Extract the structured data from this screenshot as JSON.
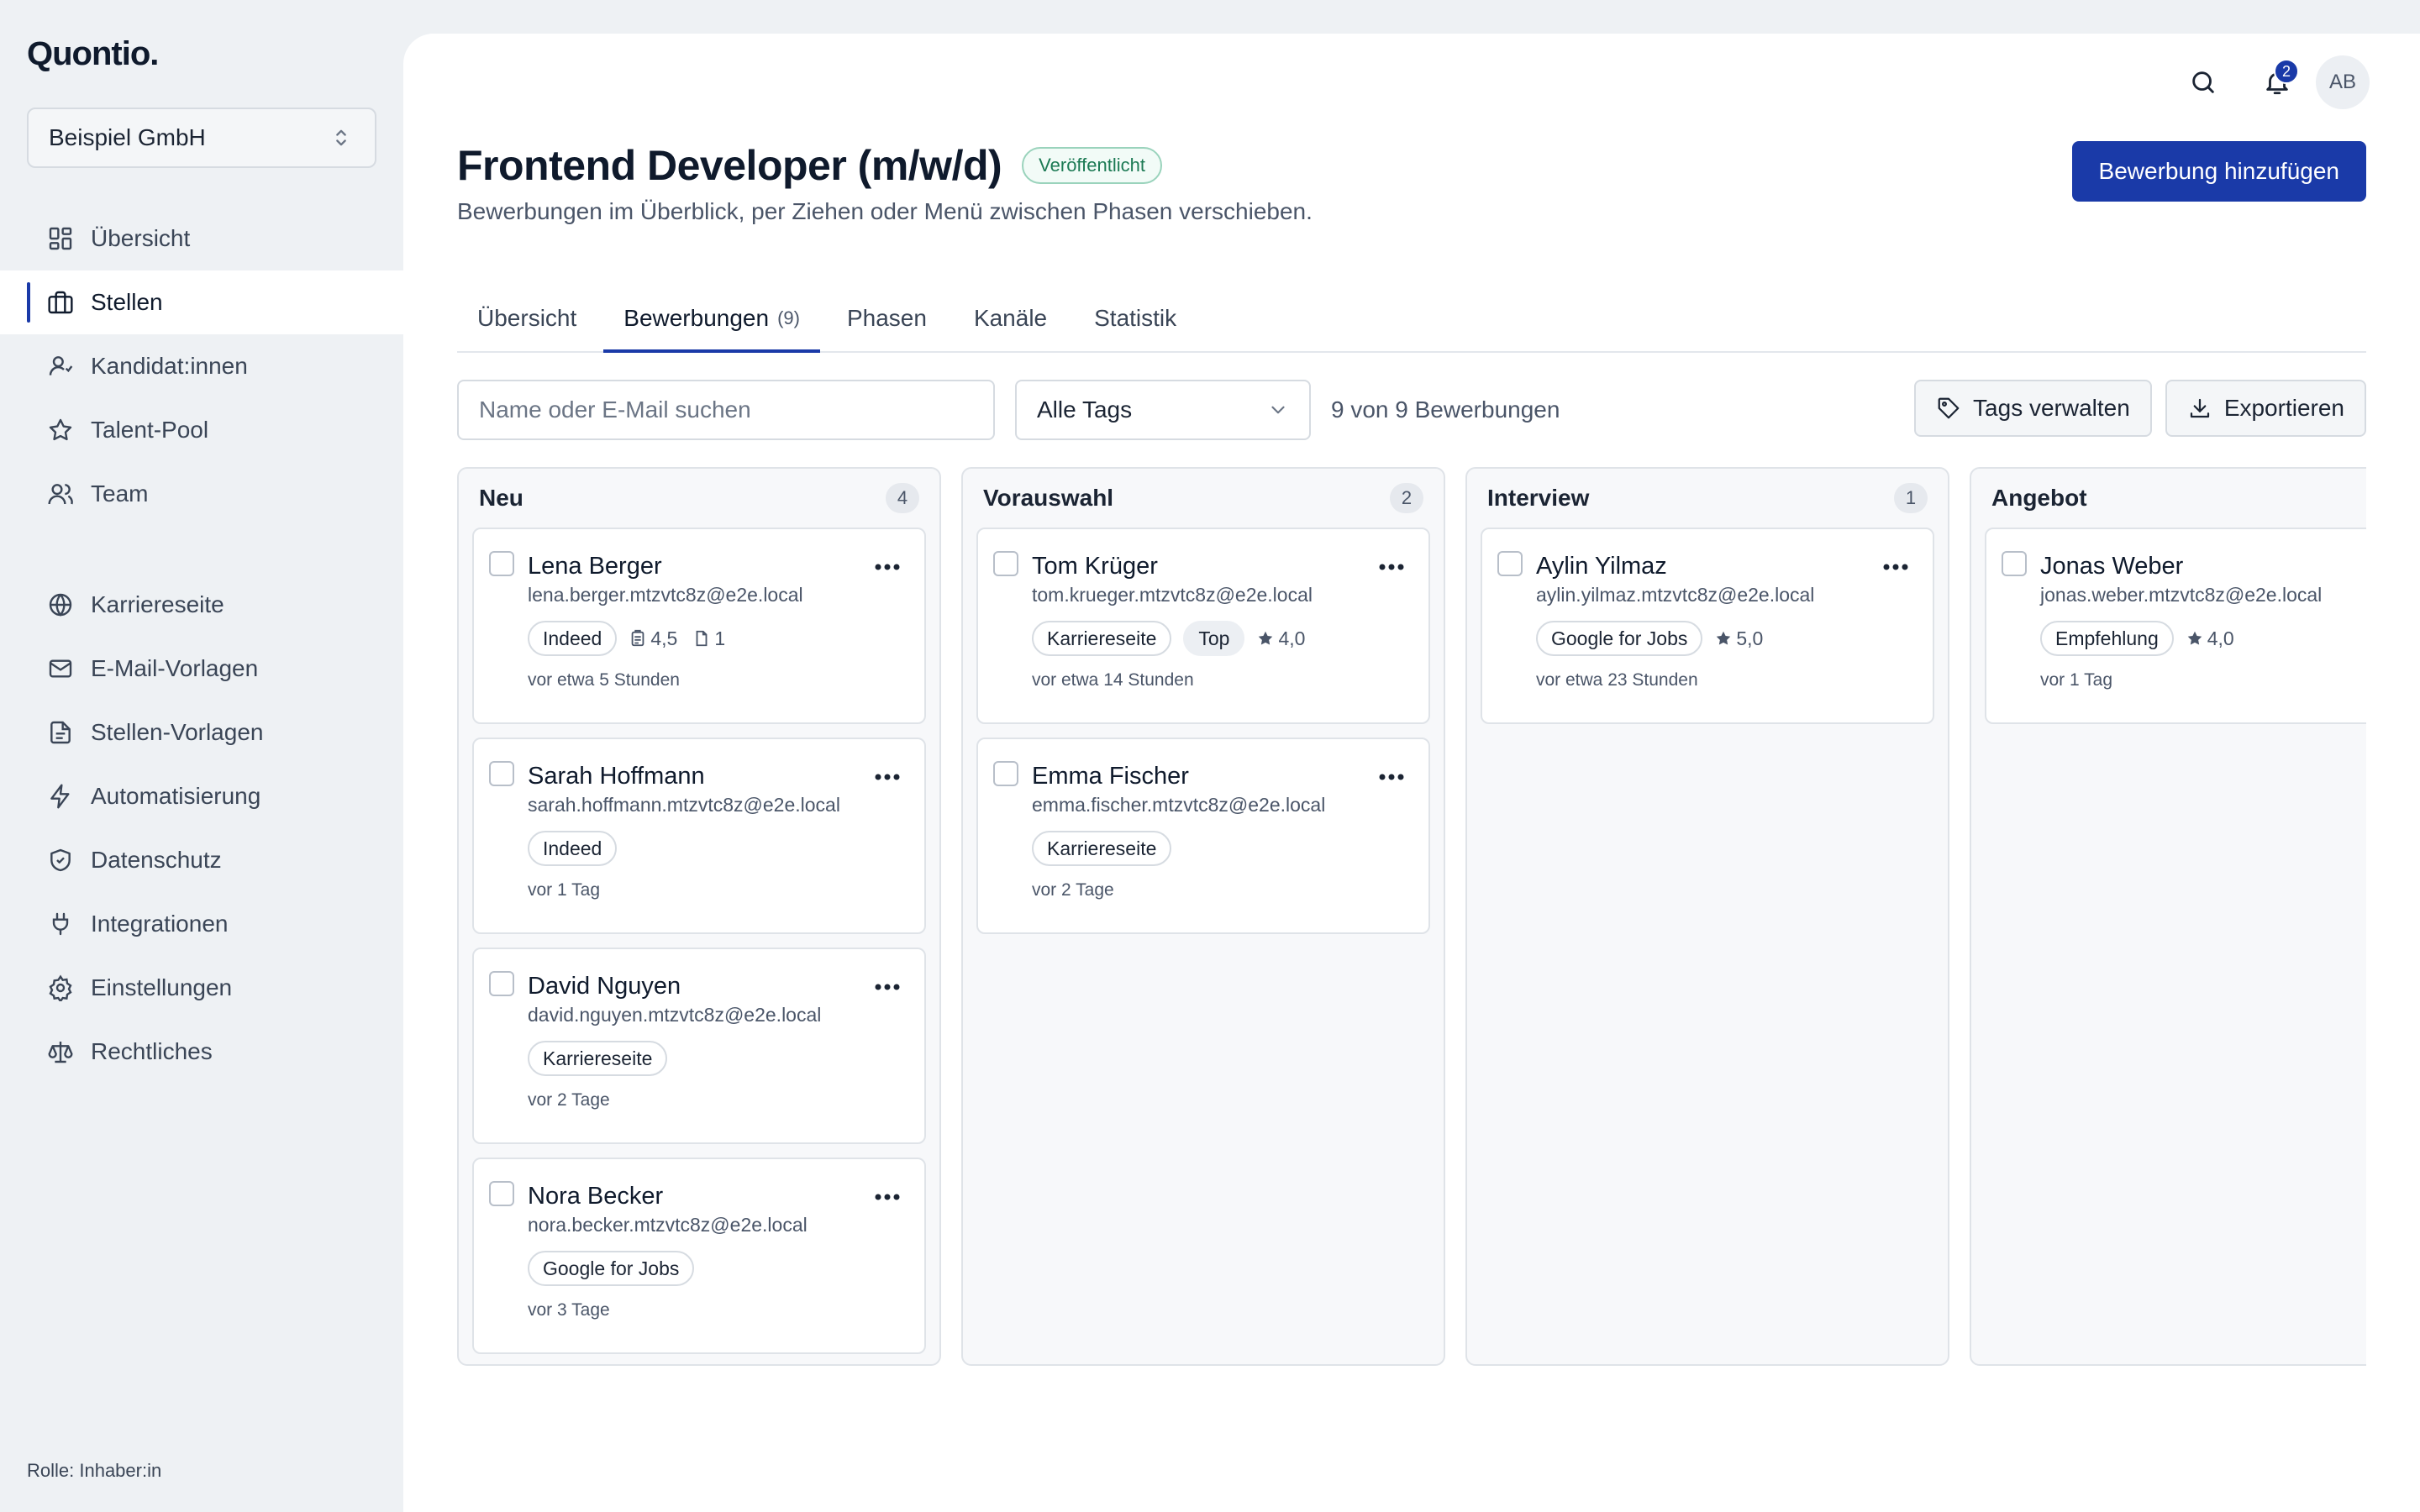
{
  "brand": "Quontio.",
  "org_select": {
    "value": "Beispiel GmbH"
  },
  "nav": {
    "main": [
      {
        "label": "Übersicht",
        "icon": "dashboard-icon"
      },
      {
        "label": "Stellen",
        "icon": "briefcase-icon",
        "active": true
      },
      {
        "label": "Kandidat:innen",
        "icon": "user-icon"
      },
      {
        "label": "Talent-Pool",
        "icon": "star-icon"
      },
      {
        "label": "Team",
        "icon": "users-icon"
      }
    ],
    "secondary": [
      {
        "label": "Karriereseite",
        "icon": "globe-icon"
      },
      {
        "label": "E-Mail-Vorlagen",
        "icon": "mail-icon"
      },
      {
        "label": "Stellen-Vorlagen",
        "icon": "document-icon"
      },
      {
        "label": "Automatisierung",
        "icon": "lightning-icon"
      },
      {
        "label": "Datenschutz",
        "icon": "shield-icon"
      },
      {
        "label": "Integrationen",
        "icon": "plug-icon"
      },
      {
        "label": "Einstellungen",
        "icon": "gear-icon"
      },
      {
        "label": "Rechtliches",
        "icon": "scale-icon"
      }
    ]
  },
  "role": "Rolle: Inhaber:in",
  "header": {
    "notifications_count": "2",
    "avatar_initials": "AB",
    "title": "Frontend Developer (m/w/d)",
    "status": "Veröffentlicht",
    "subtitle": "Bewerbungen im Überblick, per Ziehen oder Menü zwischen Phasen verschieben.",
    "primary_action": "Bewerbung hinzufügen"
  },
  "tabs": [
    {
      "label": "Übersicht"
    },
    {
      "label": "Bewerbungen",
      "count": "(9)",
      "active": true
    },
    {
      "label": "Phasen"
    },
    {
      "label": "Kanäle"
    },
    {
      "label": "Statistik"
    }
  ],
  "toolbar": {
    "search_placeholder": "Name oder E-Mail suchen",
    "tag_filter": "Alle Tags",
    "result_count": "9 von 9 Bewerbungen",
    "manage_tags": "Tags verwalten",
    "export": "Exportieren"
  },
  "colors": {
    "accent": "#1a3aa8",
    "published": "#1c7a54"
  },
  "columns": [
    {
      "title": "Neu",
      "count": "4",
      "cards": [
        {
          "name": "Lena Berger",
          "email": "lena.berger.mtzvtc8z@e2e.local",
          "source": "Indeed",
          "doc_rating": "4,5",
          "files": "1",
          "time": "vor etwa 5 Stunden"
        },
        {
          "name": "Sarah Hoffmann",
          "email": "sarah.hoffmann.mtzvtc8z@e2e.local",
          "source": "Indeed",
          "time": "vor 1 Tag"
        },
        {
          "name": "David Nguyen",
          "email": "david.nguyen.mtzvtc8z@e2e.local",
          "source": "Karriereseite",
          "time": "vor 2 Tage"
        },
        {
          "name": "Nora Becker",
          "email": "nora.becker.mtzvtc8z@e2e.local",
          "source": "Google for Jobs",
          "time": "vor 3 Tage"
        }
      ]
    },
    {
      "title": "Vorauswahl",
      "count": "2",
      "cards": [
        {
          "name": "Tom Krüger",
          "email": "tom.krueger.mtzvtc8z@e2e.local",
          "source": "Karriereseite",
          "tag": "Top",
          "rating": "4,0",
          "time": "vor etwa 14 Stunden"
        },
        {
          "name": "Emma Fischer",
          "email": "emma.fischer.mtzvtc8z@e2e.local",
          "source": "Karriereseite",
          "time": "vor 2 Tage"
        }
      ]
    },
    {
      "title": "Interview",
      "count": "1",
      "cards": [
        {
          "name": "Aylin Yilmaz",
          "email": "aylin.yilmaz.mtzvtc8z@e2e.local",
          "source": "Google for Jobs",
          "rating": "5,0",
          "time": "vor etwa 23 Stunden"
        }
      ]
    },
    {
      "title": "Angebot",
      "count": "",
      "cards": [
        {
          "name": "Jonas Weber",
          "email": "jonas.weber.mtzvtc8z@e2e.local",
          "source": "Empfehlung",
          "rating": "4,0",
          "time": "vor 1 Tag"
        }
      ]
    }
  ]
}
